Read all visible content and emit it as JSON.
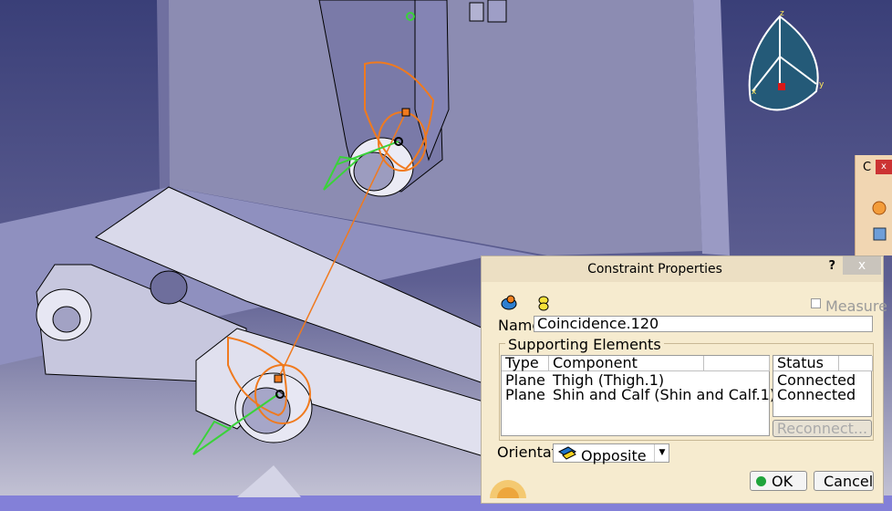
{
  "viewport": {
    "compass_axes": {
      "x": "x",
      "y": "y",
      "z": "z"
    }
  },
  "side_toolbar": {
    "title_letter": "C",
    "close_glyph": "x"
  },
  "dialog": {
    "title": "Constraint Properties",
    "help": "?",
    "close": "x",
    "measure_label": "Measure",
    "name_label": "Name:",
    "name_value": "Coincidence.120",
    "supporting_title": "Supporting Elements",
    "columns": {
      "type": "Type",
      "component": "Component",
      "status": "Status"
    },
    "rows": [
      {
        "type": "Plane",
        "component": "Thigh (Thigh.1)",
        "status": "Connected"
      },
      {
        "type": "Plane",
        "component": "Shin and Calf (Shin and Calf.1)",
        "status": "Connected"
      }
    ],
    "reconnect": "Reconnect...",
    "orientation_label": "Orientation",
    "orientation_value": "Opposite",
    "ok": "OK",
    "cancel": "Cancel",
    "colors": {
      "ok": "#1fa43c",
      "cancel": "#d8202a"
    }
  }
}
